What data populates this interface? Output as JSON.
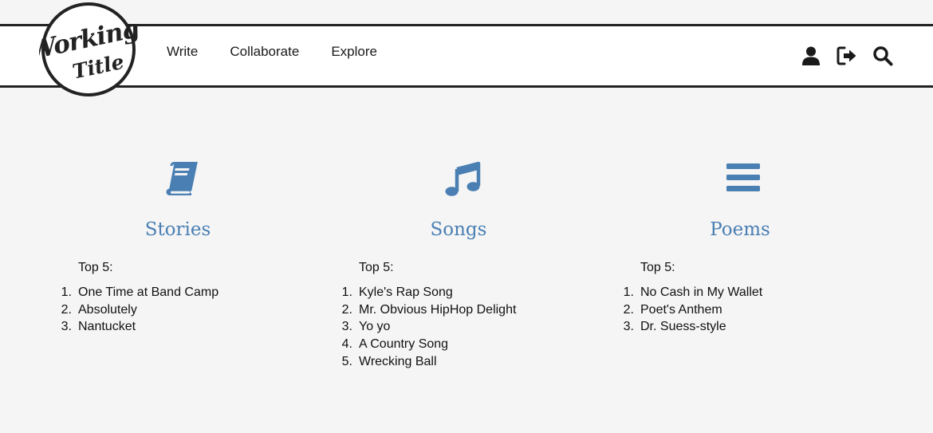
{
  "brand": {
    "logo_line1": "Working",
    "logo_line2": "Title"
  },
  "nav": {
    "links": [
      {
        "label": "Write"
      },
      {
        "label": "Collaborate"
      },
      {
        "label": "Explore"
      }
    ],
    "icons": [
      "user-icon",
      "sign-out-icon",
      "search-icon"
    ]
  },
  "colors": {
    "accent": "#4a7fb3",
    "nav_border": "#222222",
    "background": "#f5f5f5"
  },
  "columns": [
    {
      "icon": "book-icon",
      "title": "Stories",
      "top_label": "Top 5:",
      "items": [
        {
          "num": "1.",
          "label": "One Time at Band Camp"
        },
        {
          "num": "2.",
          "label": "Absolutely"
        },
        {
          "num": "3.",
          "label": "Nantucket"
        }
      ]
    },
    {
      "icon": "music-icon",
      "title": "Songs",
      "top_label": "Top 5:",
      "items": [
        {
          "num": "1.",
          "label": "Kyle's Rap Song"
        },
        {
          "num": "2.",
          "label": "Mr. Obvious HipHop Delight"
        },
        {
          "num": "3.",
          "label": "Yo yo"
        },
        {
          "num": "4.",
          "label": "A Country Song"
        },
        {
          "num": "5.",
          "label": "Wrecking Ball"
        }
      ]
    },
    {
      "icon": "bars-icon",
      "title": "Poems",
      "top_label": "Top 5:",
      "items": [
        {
          "num": "1.",
          "label": "No Cash in My Wallet"
        },
        {
          "num": "2.",
          "label": "Poet's Anthem"
        },
        {
          "num": "3.",
          "label": "Dr. Suess-style"
        }
      ]
    }
  ]
}
